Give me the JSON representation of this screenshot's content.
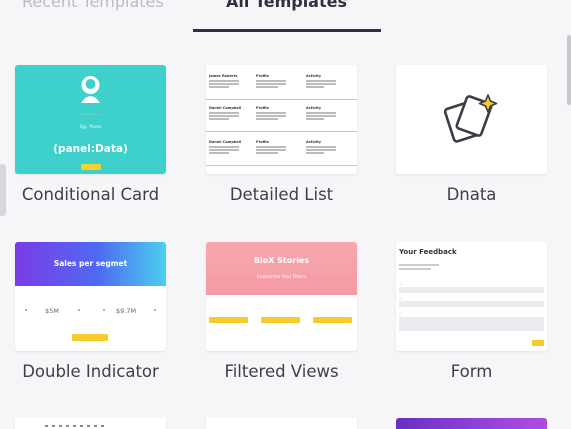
{
  "tabs": {
    "recent": "Recent Templates",
    "all": "All Templates"
  },
  "templates": [
    {
      "label": "Conditional Card"
    },
    {
      "label": "Detailed List"
    },
    {
      "label": "Dnata"
    },
    {
      "label": "Double Indicator"
    },
    {
      "label": "Filtered Views"
    },
    {
      "label": "Form"
    }
  ],
  "thumbs": {
    "conditional": {
      "name": "Sjg. Poms",
      "title": "(panel:Data)"
    },
    "detailed": {
      "rows": [
        {
          "c1": "James Roberts",
          "c2": "Profile",
          "c3": "Activity"
        },
        {
          "c1": "Daniel Campbell",
          "c2": "Profile",
          "c3": "Activity"
        },
        {
          "c1": "Daniel Campbell",
          "c2": "Profile",
          "c3": "Activity"
        }
      ]
    },
    "double_indicator": {
      "title": "Sales per segmet",
      "value_left": "$5M",
      "value_right": "$9.7M"
    },
    "filtered": {
      "title": "BloX Stories",
      "subtitle": "Customize Your Filters"
    },
    "form": {
      "title": "Your Feedback"
    }
  },
  "colors": {
    "conditional_bg": "#3ed0cb",
    "accent_yellow": "#f6cb2c",
    "tab_active": "#2a3140"
  }
}
